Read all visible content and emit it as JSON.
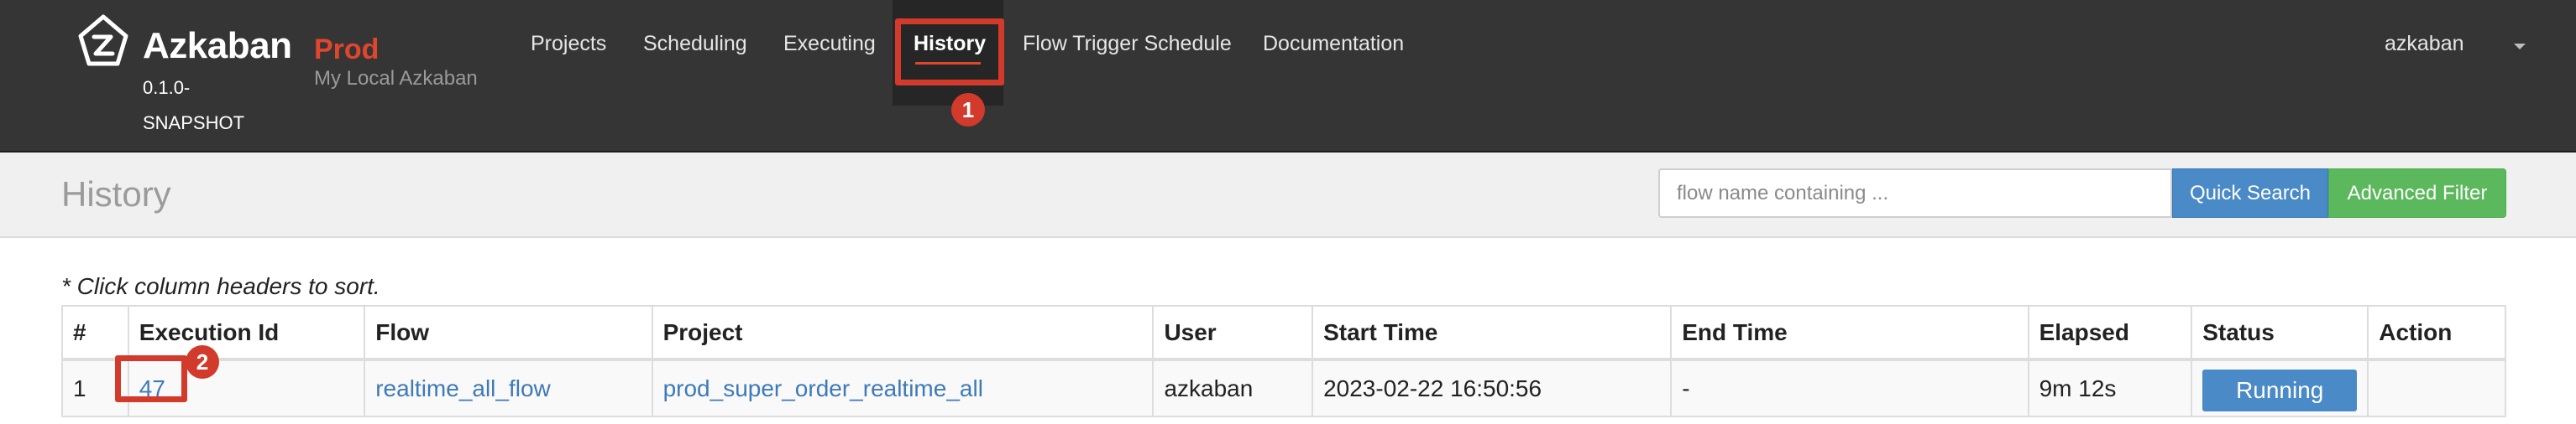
{
  "brand": {
    "name": "Azkaban",
    "version": "0.1.0-SNAPSHOT",
    "env": "Prod",
    "env_subtitle": "My Local Azkaban"
  },
  "nav": {
    "items": [
      {
        "label": "Projects"
      },
      {
        "label": "Scheduling"
      },
      {
        "label": "Executing"
      },
      {
        "label": "History",
        "active": true
      },
      {
        "label": "Flow Trigger Schedule"
      },
      {
        "label": "Documentation"
      }
    ],
    "user": "azkaban"
  },
  "annotations": {
    "badge_1": "1",
    "badge_2": "2"
  },
  "header": {
    "title": "History",
    "search_placeholder": "flow name containing ...",
    "quick_search_label": "Quick Search",
    "advanced_filter_label": "Advanced Filter"
  },
  "content": {
    "sort_hint": "* Click column headers to sort."
  },
  "table": {
    "columns": [
      "#",
      "Execution Id",
      "Flow",
      "Project",
      "User",
      "Start Time",
      "End Time",
      "Elapsed",
      "Status",
      "Action"
    ],
    "rows": [
      {
        "index": "1",
        "execution_id": "47",
        "flow": "realtime_all_flow",
        "project": "prod_super_order_realtime_all",
        "user": "azkaban",
        "start_time": "2023-02-22 16:50:56",
        "end_time": "-",
        "elapsed": "9m 12s",
        "status": "Running",
        "action": ""
      }
    ]
  },
  "colors": {
    "navbar": "#353535",
    "accent_red": "#e0452e",
    "annotation_red": "#d23a2b",
    "primary_blue": "#4a8ac6",
    "success_green": "#5cb85c",
    "link_blue": "#3d7ab8"
  }
}
